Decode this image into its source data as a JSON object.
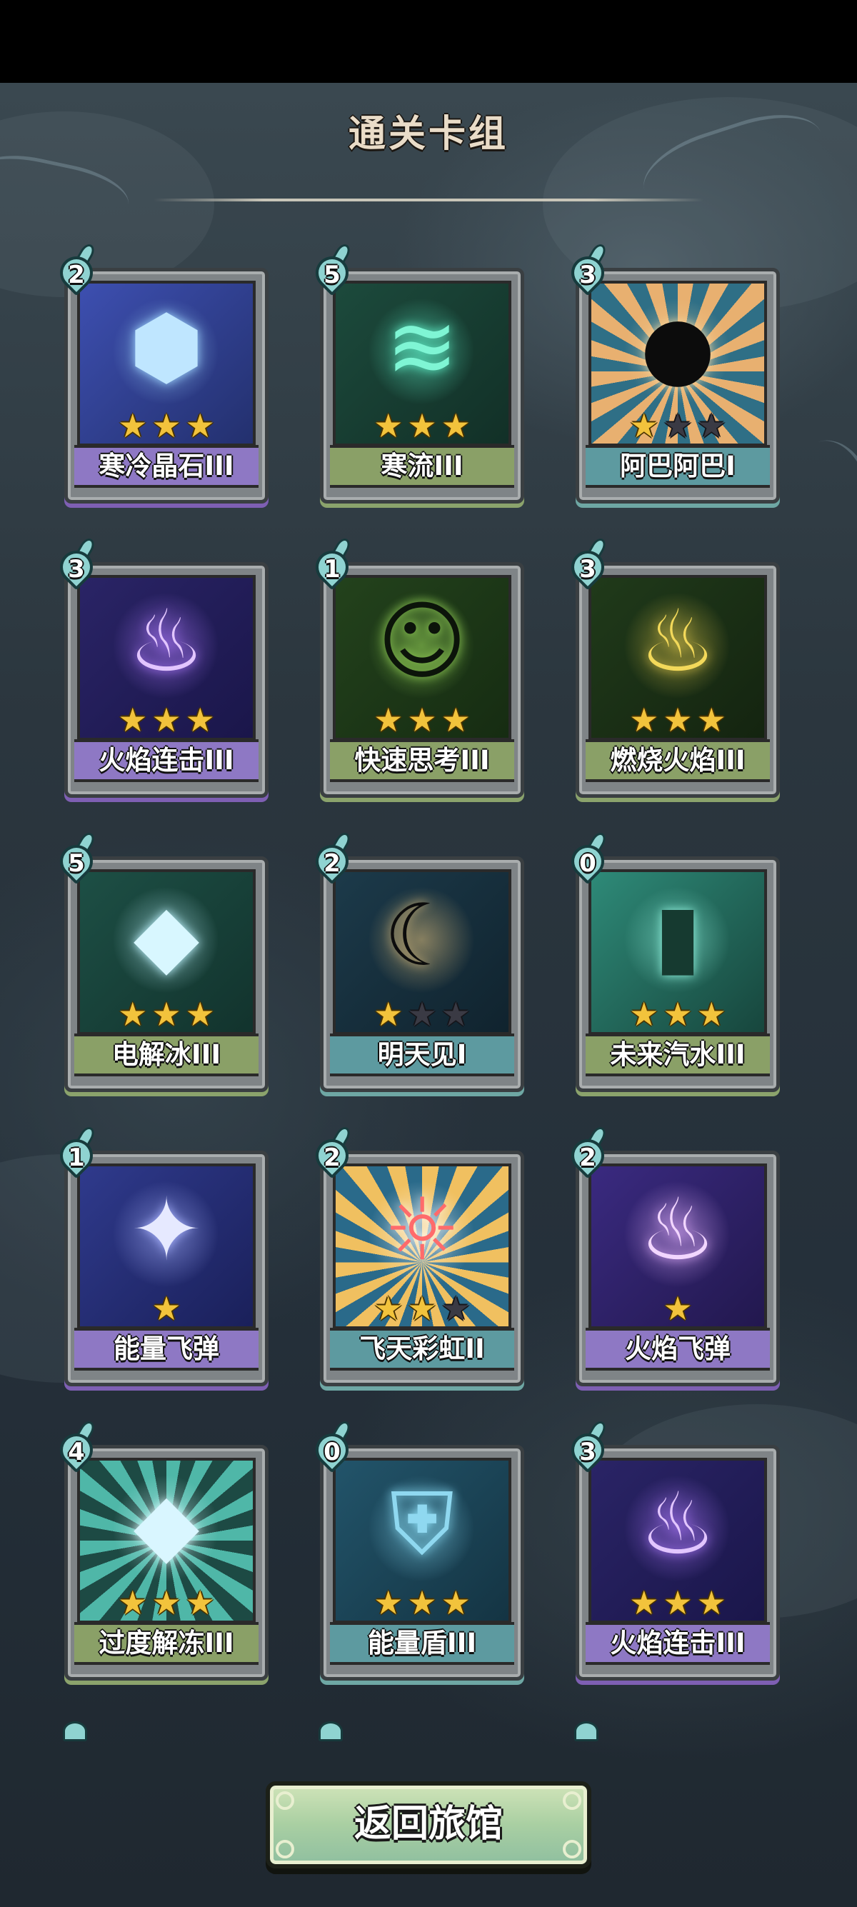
{
  "title": "通关卡组",
  "return_button": "返回旅馆",
  "colors": {
    "purple": "#8e78c4",
    "green": "#8aa067",
    "teal": "#5d9aa0",
    "star": "#f2c33c"
  },
  "cards": [
    {
      "cost": "2",
      "name": "寒冷晶石III",
      "stars": 3,
      "max_stars": 3,
      "frame": "purple",
      "icon": "ice-crystal-icon"
    },
    {
      "cost": "5",
      "name": "寒流III",
      "stars": 3,
      "max_stars": 3,
      "frame": "green",
      "icon": "cold-wave-icon"
    },
    {
      "cost": "3",
      "name": "阿巴阿巴I",
      "stars": 1,
      "max_stars": 3,
      "frame": "teal",
      "icon": "shadow-creature-icon"
    },
    {
      "cost": "3",
      "name": "火焰连击III",
      "stars": 3,
      "max_stars": 3,
      "frame": "purple",
      "icon": "purple-flame-icon"
    },
    {
      "cost": "1",
      "name": "快速思考III",
      "stars": 3,
      "max_stars": 3,
      "frame": "green",
      "icon": "thinking-figure-icon"
    },
    {
      "cost": "3",
      "name": "燃烧火焰III",
      "stars": 3,
      "max_stars": 3,
      "frame": "green",
      "icon": "fire-icon"
    },
    {
      "cost": "5",
      "name": "电解冰III",
      "stars": 3,
      "max_stars": 3,
      "frame": "green",
      "icon": "electric-ice-icon"
    },
    {
      "cost": "2",
      "name": "明天见I",
      "stars": 1,
      "max_stars": 3,
      "frame": "teal",
      "icon": "sleeping-figure-icon"
    },
    {
      "cost": "0",
      "name": "未来汽水III",
      "stars": 3,
      "max_stars": 3,
      "frame": "green",
      "icon": "soda-bottle-icon"
    },
    {
      "cost": "1",
      "name": "能量飞弹",
      "stars": 1,
      "max_stars": 1,
      "frame": "purple",
      "icon": "energy-missile-icon"
    },
    {
      "cost": "2",
      "name": "飞天彩虹II",
      "stars": 2,
      "max_stars": 3,
      "frame": "teal",
      "icon": "rainbow-wings-icon"
    },
    {
      "cost": "2",
      "name": "火焰飞弹",
      "stars": 1,
      "max_stars": 1,
      "frame": "purple",
      "icon": "flame-missile-icon"
    },
    {
      "cost": "4",
      "name": "过度解冻III",
      "stars": 3,
      "max_stars": 3,
      "frame": "green",
      "icon": "ice-cube-icon"
    },
    {
      "cost": "0",
      "name": "能量盾III",
      "stars": 3,
      "max_stars": 3,
      "frame": "teal",
      "icon": "shield-icon"
    },
    {
      "cost": "3",
      "name": "火焰连击III",
      "stars": 3,
      "max_stars": 3,
      "frame": "purple",
      "icon": "purple-flame-icon"
    }
  ]
}
